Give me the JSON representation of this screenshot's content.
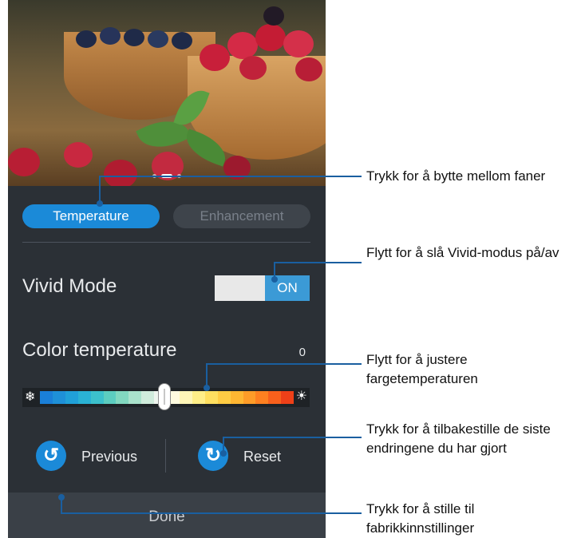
{
  "settings_panel": {
    "tabs": [
      {
        "label": "Temperature",
        "active": true
      },
      {
        "label": "Enhancement",
        "active": false
      }
    ],
    "vivid_mode": {
      "label": "Vivid Mode",
      "toggle_label": "ON",
      "enabled": true
    },
    "color_temperature": {
      "label": "Color temperature",
      "value": "0",
      "slider_position": 0.5,
      "min_icon": "snowflake-icon",
      "max_icon": "sun-icon"
    },
    "previous_button": {
      "label": "Previous",
      "icon": "undo-icon"
    },
    "reset_button": {
      "label": "Reset",
      "icon": "reset-icon"
    },
    "done_button": {
      "label": "Done"
    },
    "page_indicator": {
      "count": 3,
      "active_index": 1
    }
  },
  "callouts": [
    {
      "text": "Trykk for å bytte mellom faner"
    },
    {
      "text": "Flytt for å slå Vivid-modus på/av"
    },
    {
      "text": "Flytt for å justere fargetemperaturen"
    },
    {
      "text": "Trykk for å tilbakestille de siste endringene du har gjort"
    },
    {
      "text": "Trykk for å stille til fabrikkinnstillinger"
    }
  ],
  "colors": {
    "accent": "#1b8ad8",
    "panel_bg": "#2b3036",
    "leader_line": "#1a5fa0"
  }
}
